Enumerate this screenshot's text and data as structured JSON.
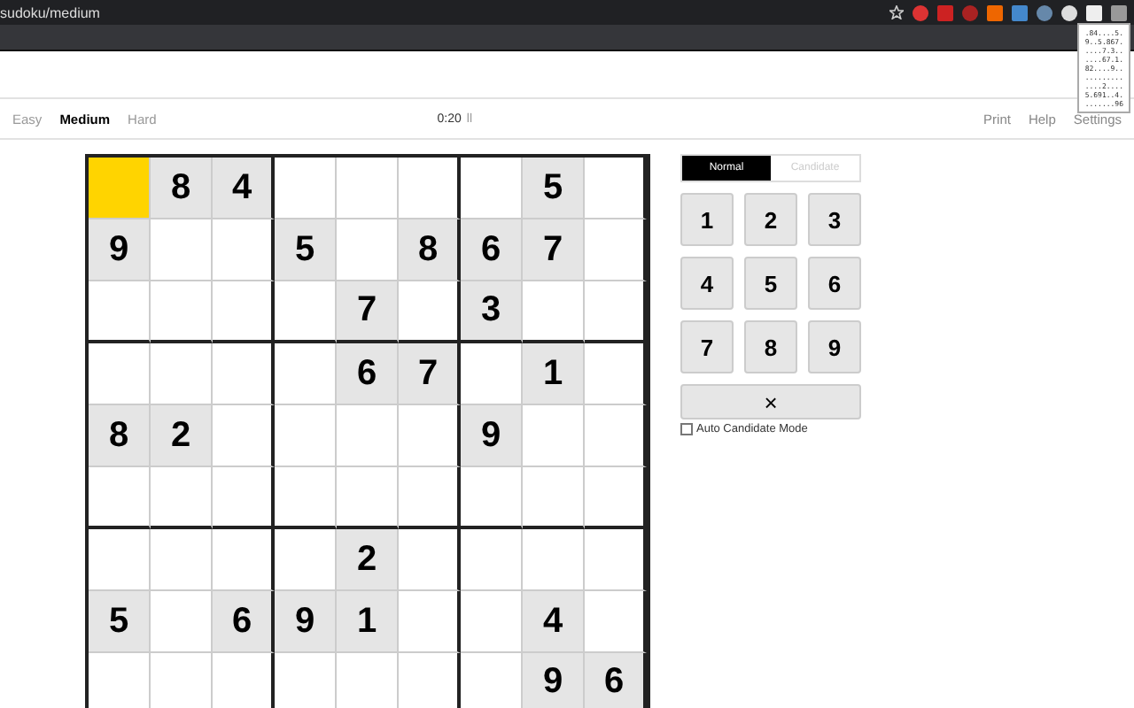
{
  "browser": {
    "url": "sudoku/medium",
    "popup_lines": [
      ".84....5.",
      "9..5.867.",
      "....7.3..",
      "....67.1.",
      "82....9..",
      ".........",
      "....2....",
      "5.691..4.",
      ".......96"
    ]
  },
  "nav": {
    "levels": [
      {
        "label": "Easy",
        "selected": false
      },
      {
        "label": "Medium",
        "selected": true
      },
      {
        "label": "Hard",
        "selected": false
      }
    ],
    "timer": "0:20",
    "pause": "ll",
    "links": [
      "Print",
      "Help",
      "Settings"
    ]
  },
  "grid": [
    [
      {
        "selected": true
      },
      {
        "value": "8",
        "selected": false
      },
      {
        "value": "4",
        "selected": false
      },
      {
        "selected": false
      },
      {
        "selected": false
      },
      {
        "selected": false
      },
      {
        "selected": false
      },
      {
        "value": "5",
        "selected": false
      },
      {
        "selected": false
      }
    ],
    [
      {
        "value": "9",
        "selected": false
      },
      {
        "selected": false
      },
      {
        "selected": false
      },
      {
        "value": "5",
        "selected": false
      },
      {
        "selected": false
      },
      {
        "value": "8",
        "selected": false
      },
      {
        "value": "6",
        "selected": false
      },
      {
        "value": "7",
        "selected": false
      },
      {
        "selected": false
      }
    ],
    [
      {
        "selected": false
      },
      {
        "selected": false
      },
      {
        "selected": false
      },
      {
        "selected": false
      },
      {
        "value": "7",
        "selected": false
      },
      {
        "selected": false
      },
      {
        "value": "3",
        "selected": false
      },
      {
        "selected": false
      },
      {
        "selected": false
      }
    ],
    [
      {
        "selected": false
      },
      {
        "selected": false
      },
      {
        "selected": false
      },
      {
        "selected": false
      },
      {
        "value": "6",
        "selected": false
      },
      {
        "value": "7",
        "selected": false
      },
      {
        "selected": false
      },
      {
        "value": "1",
        "selected": false
      },
      {
        "selected": false
      }
    ],
    [
      {
        "value": "8",
        "selected": false
      },
      {
        "value": "2",
        "selected": false
      },
      {
        "selected": false
      },
      {
        "selected": false
      },
      {
        "selected": false
      },
      {
        "selected": false
      },
      {
        "value": "9",
        "selected": false
      },
      {
        "selected": false
      },
      {
        "selected": false
      }
    ],
    [
      {
        "selected": false
      },
      {
        "selected": false
      },
      {
        "selected": false
      },
      {
        "selected": false
      },
      {
        "selected": false
      },
      {
        "selected": false
      },
      {
        "selected": false
      },
      {
        "selected": false
      },
      {
        "selected": false
      }
    ],
    [
      {
        "selected": false
      },
      {
        "selected": false
      },
      {
        "selected": false
      },
      {
        "selected": false
      },
      {
        "value": "2",
        "selected": false
      },
      {
        "selected": false
      },
      {
        "selected": false
      },
      {
        "selected": false
      },
      {
        "selected": false
      }
    ],
    [
      {
        "value": "5",
        "selected": false
      },
      {
        "selected": false
      },
      {
        "value": "6",
        "selected": false
      },
      {
        "value": "9",
        "selected": false
      },
      {
        "value": "1",
        "selected": false
      },
      {
        "selected": false
      },
      {
        "selected": false
      },
      {
        "value": "4",
        "selected": false
      },
      {
        "selected": false
      }
    ],
    [
      {
        "selected": false
      },
      {
        "selected": false
      },
      {
        "selected": false
      },
      {
        "selected": false
      },
      {
        "selected": false
      },
      {
        "selected": false
      },
      {
        "selected": false
      },
      {
        "value": "9",
        "selected": false
      },
      {
        "value": "6",
        "selected": false
      }
    ]
  ],
  "modes": [
    {
      "label": "Normal",
      "selected": true
    },
    {
      "label": "Candidate",
      "selected": false
    }
  ],
  "keys": [
    "1",
    "2",
    "3",
    "4",
    "5",
    "6",
    "7",
    "8",
    "9"
  ],
  "erase": "×",
  "auto_candidate": {
    "label": "Auto Candidate Mode",
    "checked": false
  }
}
